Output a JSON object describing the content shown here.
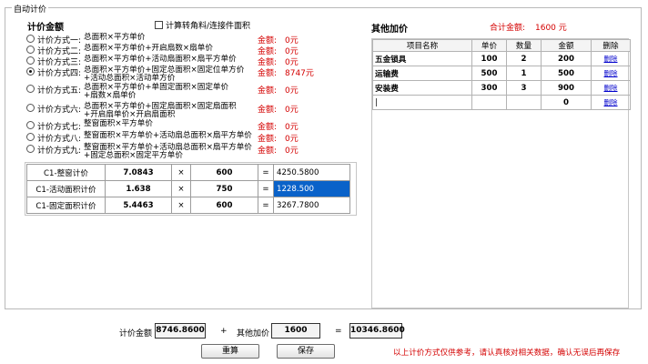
{
  "group_title": "自动计价",
  "pricing": {
    "title": "计价金额",
    "checkbox_label": "计算转角料/连接件面积",
    "amount_label": "金额:",
    "methods": [
      {
        "label": "计价方式一:",
        "formula": [
          "总面积×平方单价"
        ],
        "amount": "0元",
        "selected": false
      },
      {
        "label": "计价方式二:",
        "formula": [
          "总面积×平方单价+开启扇数×扇单价"
        ],
        "amount": "0元",
        "selected": false
      },
      {
        "label": "计价方式三:",
        "formula": [
          "总面积×平方单价+活动扇面积×扇平方单价"
        ],
        "amount": "0元",
        "selected": false
      },
      {
        "label": "计价方式四:",
        "formula": [
          "总面积×平方单价+固定总面积×固定位单方价",
          "+活动总面积×活动单方价"
        ],
        "amount": "8747元",
        "selected": true
      },
      {
        "label": "计价方式五:",
        "formula": [
          "总面积×平方单价+单固定面积×固定单价",
          "+扇数×扇单价"
        ],
        "amount": "0元",
        "selected": false
      },
      {
        "label": "计价方式六:",
        "formula": [
          "总面积×平方单价+固定扇面积×固定扇面积",
          "+开启扇单价×开启扇面积"
        ],
        "amount": "0元",
        "selected": false
      },
      {
        "label": "计价方式七:",
        "formula": [
          "整窗面积×平方单价"
        ],
        "amount": "0元",
        "selected": false
      },
      {
        "label": "计价方式八:",
        "formula": [
          "整窗面积×平方单价+活动扇总面积×扇平方单价"
        ],
        "amount": "0元",
        "selected": false
      },
      {
        "label": "计价方式九:",
        "formula": [
          "整窗面积×平方单价+活动扇总面积×扇平方单价",
          "+固定总面积×固定平方单价"
        ],
        "amount": "0元",
        "selected": false
      }
    ],
    "calc_rows": [
      {
        "label": "C1-整窗计价",
        "value": "7.0843",
        "op": "×",
        "qty": "600",
        "eq": "=",
        "result": "4250.5800",
        "selected": false
      },
      {
        "label": "C1-活动面积计价",
        "value": "1.638",
        "op": "×",
        "qty": "750",
        "eq": "=",
        "result": "1228.500",
        "selected": true
      },
      {
        "label": "C1-固定面积计价",
        "value": "5.4463",
        "op": "×",
        "qty": "600",
        "eq": "=",
        "result": "3267.7800",
        "selected": false
      }
    ]
  },
  "other": {
    "title": "其他加价",
    "total_label": "合计金额:",
    "total_value": "1600 元",
    "columns": [
      "项目名称",
      "单价",
      "数量",
      "金额",
      "删除"
    ],
    "rows": [
      {
        "name": "五金锁具",
        "price": "100",
        "qty": "2",
        "amount": "200",
        "del": "删除"
      },
      {
        "name": "运输费",
        "price": "500",
        "qty": "1",
        "amount": "500",
        "del": "删除"
      },
      {
        "name": "安装费",
        "price": "300",
        "qty": "3",
        "amount": "900",
        "del": "删除"
      },
      {
        "name": "|",
        "price": "",
        "qty": "",
        "amount": "0",
        "del": "删除"
      }
    ]
  },
  "summary": {
    "price_label": "计价金额",
    "price_value": "8746.8600",
    "plus": "+",
    "other_label": "其他加价",
    "other_value": "1600",
    "equals": "=",
    "total_value": "10346.8600",
    "recalc_button": "重算",
    "save_button": "保存",
    "notice": "以上计价方式仅供参考，请认真核对相关数据，确认无误后再保存"
  },
  "colors": {
    "accent_red": "#d40000",
    "selection_blue": "#0a62c9",
    "link_blue": "#0000cc"
  }
}
